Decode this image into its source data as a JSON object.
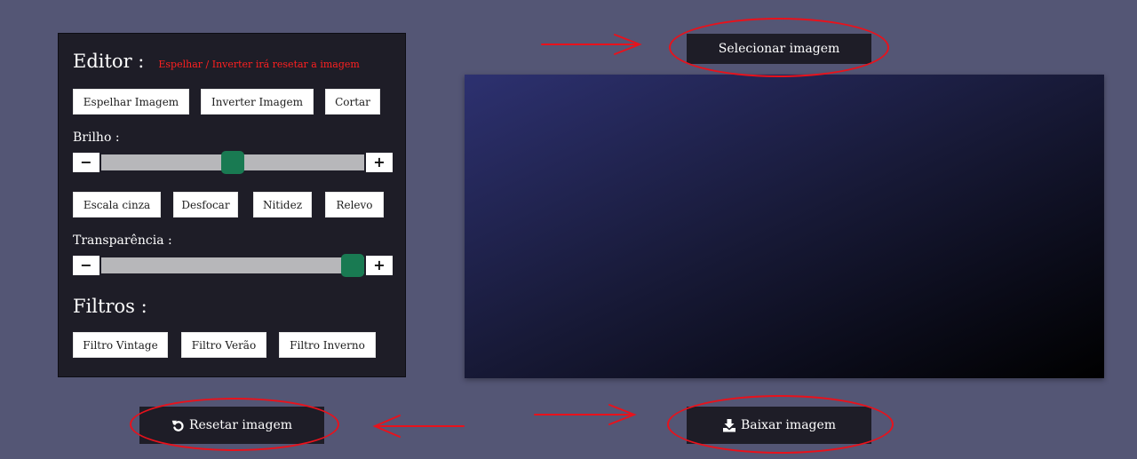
{
  "editor": {
    "title": "Editor :",
    "warning": "Espelhar / Inverter irá resetar a imagem",
    "buttons": {
      "mirror": "Espelhar Imagem",
      "invert": "Inverter Imagem",
      "crop": "Cortar",
      "grayscale": "Escala cinza",
      "blur": "Desfocar",
      "sharpen": "Nitidez",
      "emboss": "Relevo"
    },
    "brightness": {
      "label": "Brilho :",
      "value": 0.5,
      "minus": "−",
      "plus": "+"
    },
    "transparency": {
      "label": "Transparência :",
      "value": 1.0,
      "minus": "−",
      "plus": "+"
    }
  },
  "filters": {
    "title": "Filtros :",
    "buttons": {
      "vintage": "Filtro Vintage",
      "summer": "Filtro Verão",
      "winter": "Filtro Inverno"
    }
  },
  "actions": {
    "select_image": "Selecionar imagem",
    "reset_image": "Resetar imagem",
    "download_image": "Baixar imagem"
  },
  "colors": {
    "page_background": "#545675",
    "panel_background": "#1e1d27",
    "warning_text": "#ff2020",
    "slider_thumb": "#197a52",
    "annotation_red": "#e8121c"
  },
  "icons": {
    "reset": "undo-arrow-icon",
    "download": "download-icon"
  }
}
